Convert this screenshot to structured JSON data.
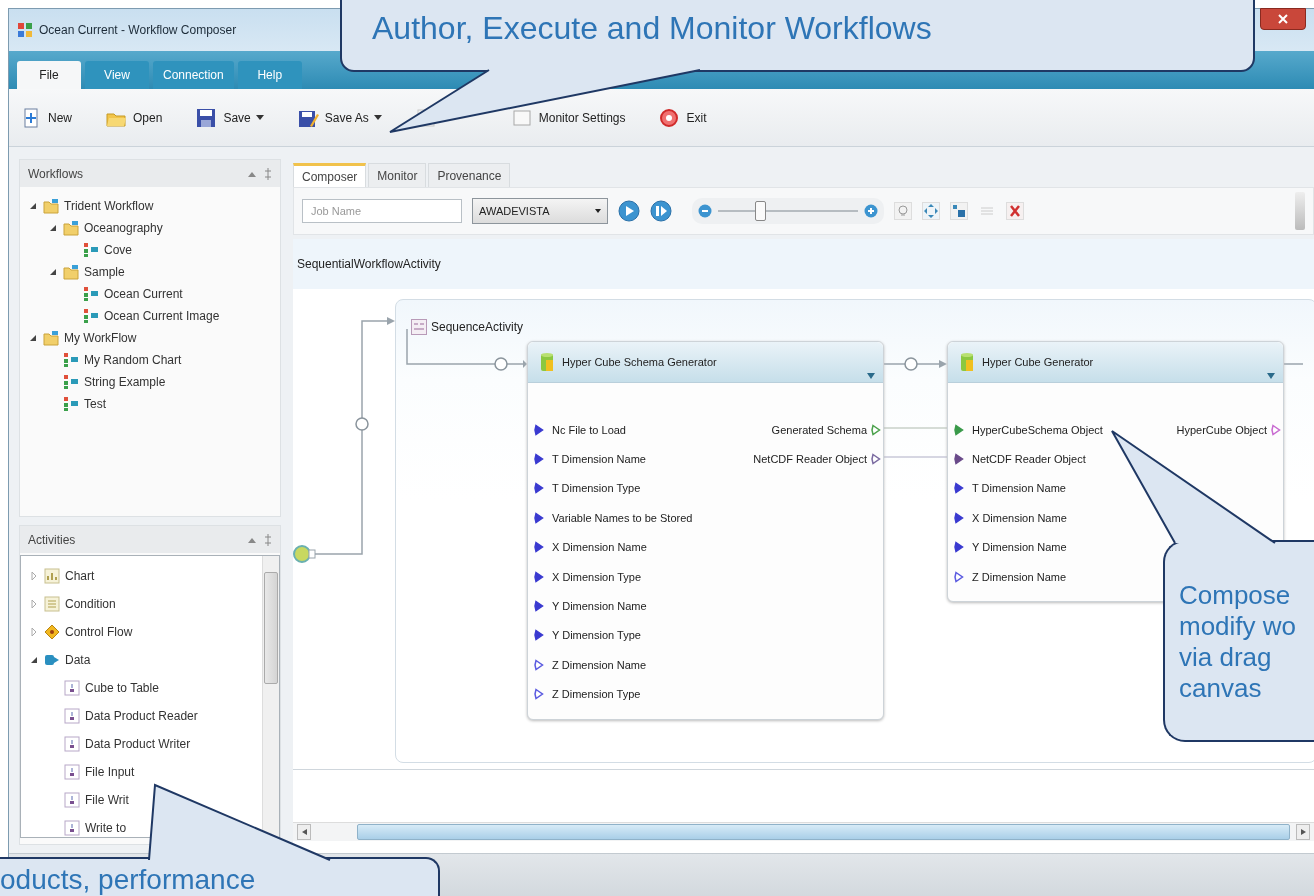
{
  "window": {
    "title": "Ocean Current - Workflow Composer"
  },
  "ribbon_tabs": [
    {
      "label": "File",
      "selected": true
    },
    {
      "label": "View",
      "selected": false
    },
    {
      "label": "Connection",
      "selected": false
    },
    {
      "label": "Help",
      "selected": false
    }
  ],
  "toolbar": [
    {
      "kind": "new",
      "label": "New",
      "dropdown": false
    },
    {
      "kind": "open",
      "label": "Open",
      "dropdown": false
    },
    {
      "kind": "save",
      "label": "Save",
      "dropdown": true
    },
    {
      "kind": "saveas",
      "label": "Save As",
      "dropdown": true
    },
    {
      "kind": "import",
      "dropdown": false
    },
    {
      "kind": "monitor",
      "label": "Monitor Settings",
      "dropdown": false
    },
    {
      "kind": "exit",
      "label": "Exit",
      "dropdown": false
    }
  ],
  "workflows_panel": {
    "title": "Workflows",
    "tree": [
      {
        "kind": "folder",
        "label": "Trident Workflow",
        "expanded": true,
        "children": [
          {
            "kind": "folder",
            "label": "Oceanography",
            "expanded": true,
            "children": [
              {
                "kind": "workflow",
                "label": "Cove"
              }
            ]
          },
          {
            "kind": "folder",
            "label": "Sample",
            "expanded": true,
            "children": [
              {
                "kind": "workflow",
                "label": "Ocean Current"
              },
              {
                "kind": "workflow",
                "label": "Ocean Current Image"
              }
            ]
          }
        ]
      },
      {
        "kind": "folder",
        "label": "My WorkFlow",
        "expanded": true,
        "children": [
          {
            "kind": "workflow",
            "label": "My Random Chart"
          },
          {
            "kind": "workflow",
            "label": "String Example"
          },
          {
            "kind": "workflow",
            "label": "Test"
          }
        ]
      }
    ]
  },
  "activities_panel": {
    "title": "Activities",
    "tree": [
      {
        "kind": "chart",
        "label": "Chart",
        "expanded": false
      },
      {
        "kind": "condition",
        "label": "Condition",
        "expanded": false
      },
      {
        "kind": "control",
        "label": "Control Flow",
        "expanded": false
      },
      {
        "kind": "data",
        "label": "Data",
        "expanded": true,
        "children": [
          {
            "kind": "activity",
            "label": "Cube to Table"
          },
          {
            "kind": "activity",
            "label": "Data Product Reader"
          },
          {
            "kind": "activity",
            "label": "Data Product Writer"
          },
          {
            "kind": "activity",
            "label": "File Input"
          },
          {
            "kind": "activity",
            "label": "File Writ"
          },
          {
            "kind": "activity",
            "label": "Write to"
          }
        ]
      }
    ]
  },
  "editor_tabs": [
    {
      "label": "Composer",
      "selected": true
    },
    {
      "label": "Monitor",
      "selected": false
    },
    {
      "label": "Provenance",
      "selected": false
    }
  ],
  "editor_toolbar": {
    "job_name": {
      "placeholder": "Job Name"
    },
    "machine": {
      "value": "AWADEVISTA"
    },
    "zoom": {
      "level": 0.3
    }
  },
  "canvas": {
    "workflow_label": "SequentialWorkflowActivity",
    "sequence_label": "SequenceActivity",
    "activities": [
      {
        "title": "Hyper Cube Schema Generator",
        "inputs": [
          {
            "label": "Nc File to Load",
            "kind": "required"
          },
          {
            "label": "T Dimension Name",
            "kind": "required"
          },
          {
            "label": "T Dimension Type",
            "kind": "required"
          },
          {
            "label": "Variable Names to be Stored",
            "kind": "required"
          },
          {
            "label": "X Dimension Name",
            "kind": "required"
          },
          {
            "label": "X Dimension Type",
            "kind": "required"
          },
          {
            "label": "Y Dimension Name",
            "kind": "required"
          },
          {
            "label": "Y Dimension Type",
            "kind": "required"
          },
          {
            "label": "Z Dimension Name",
            "kind": "optional"
          },
          {
            "label": "Z Dimension Type",
            "kind": "optional"
          }
        ],
        "outputs": [
          {
            "label": "Generated Schema",
            "kind": "schema-out"
          },
          {
            "label": "NetCDF Reader Object",
            "kind": "reader-out"
          }
        ]
      },
      {
        "title": "Hyper Cube Generator",
        "inputs": [
          {
            "label": "HyperCubeSchema Object",
            "kind": "schema-in"
          },
          {
            "label": "NetCDF Reader Object",
            "kind": "reader-in"
          },
          {
            "label": "T Dimension Name",
            "kind": "required"
          },
          {
            "label": "X Dimension Name",
            "kind": "required"
          },
          {
            "label": "Y Dimension Name",
            "kind": "required"
          },
          {
            "label": "Z Dimension Name",
            "kind": "optional"
          }
        ],
        "outputs": [
          {
            "label": "HyperCube Object",
            "kind": "cube-out"
          }
        ]
      }
    ]
  },
  "callouts": [
    {
      "lines": [
        "Author, Execute and Monitor Workflows"
      ]
    },
    {
      "lines": [
        "Compose",
        "modify wo",
        "via drag",
        "canvas"
      ]
    },
    {
      "lines": [
        "oducts, performance"
      ]
    }
  ]
}
